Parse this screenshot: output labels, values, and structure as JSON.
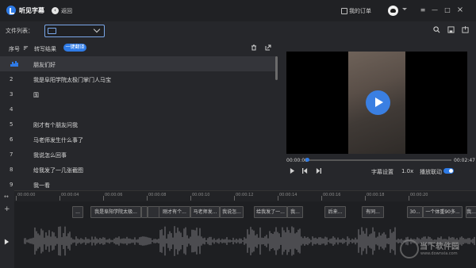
{
  "app": {
    "title": "听见字幕",
    "back_label": "返回",
    "orders_label": "我的订单"
  },
  "window": {
    "menu": "≡",
    "minimize": "—",
    "maximize": "□",
    "close": "×"
  },
  "filebar": {
    "label": "文件列表："
  },
  "list_header": {
    "col_index": "序号",
    "col_result": "转写结果",
    "translate_button": "一键翻译"
  },
  "rows": [
    {
      "num": "",
      "text": "朋友们好"
    },
    {
      "num": "2",
      "text": "我是阜阳学院太极门掌门人马宝"
    },
    {
      "num": "3",
      "text": "国"
    },
    {
      "num": "4",
      "text": ""
    },
    {
      "num": "5",
      "text": "刚才有个朋友问我"
    },
    {
      "num": "6",
      "text": "马老师发生什么事了"
    },
    {
      "num": "7",
      "text": "我说怎么回事"
    },
    {
      "num": "8",
      "text": "给我发了一几张截图"
    },
    {
      "num": "9",
      "text": "我一看"
    }
  ],
  "player": {
    "time_current": "00:00:00",
    "time_total": "00:02:47",
    "progress": 0.0,
    "subtitle_settings": "字幕设置",
    "speed": "1.0x",
    "sync_label": "播放联动",
    "sync_on": true
  },
  "ruler": {
    "ticks": [
      "00:00:00",
      "00:00:04",
      "00:00:06",
      "00:00:08",
      "00:00:10",
      "00:00:12",
      "00:00:14",
      "00:00:16",
      "00:00:18",
      "00:00:20"
    ]
  },
  "segments": [
    "...",
    "我是阜阳学院太极...",
    "",
    "",
    "刚才有个...",
    "马老师发...",
    "我说怎...",
    "给我发了一...",
    "我...",
    "后来...",
    "有同...",
    "30...",
    "一个体重90多...",
    "我..."
  ],
  "watermark": {
    "text": "当下软件园",
    "url": "www.downxia.com"
  },
  "colors": {
    "accent": "#2f7be6",
    "bg": "#26272b",
    "titlebar": "#202124"
  }
}
